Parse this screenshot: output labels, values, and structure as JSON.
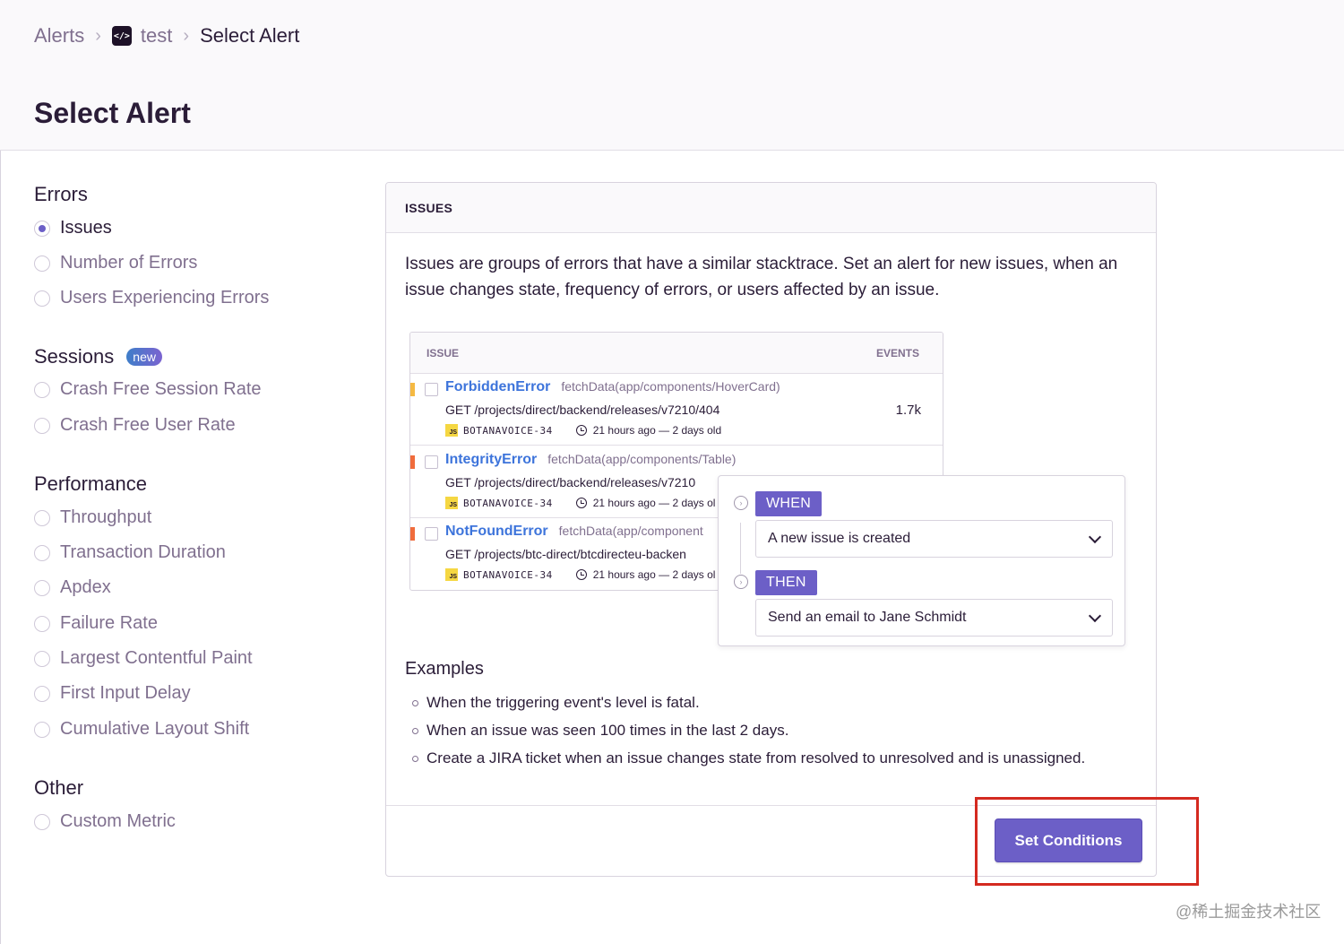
{
  "breadcrumb": {
    "alerts": "Alerts",
    "project_icon": "</>",
    "project": "test",
    "current": "Select Alert"
  },
  "page_title": "Select Alert",
  "groups": {
    "errors": {
      "title": "Errors",
      "options": [
        "Issues",
        "Number of Errors",
        "Users Experiencing Errors"
      ]
    },
    "sessions": {
      "title": "Sessions",
      "badge": "new",
      "options": [
        "Crash Free Session Rate",
        "Crash Free User Rate"
      ]
    },
    "performance": {
      "title": "Performance",
      "options": [
        "Throughput",
        "Transaction Duration",
        "Apdex",
        "Failure Rate",
        "Largest Contentful Paint",
        "First Input Delay",
        "Cumulative Layout Shift"
      ]
    },
    "other": {
      "title": "Other",
      "options": [
        "Custom Metric"
      ]
    }
  },
  "selected_option": "Issues",
  "panel": {
    "header": "ISSUES",
    "description": "Issues are groups of errors that have a similar stacktrace. Set an alert for new issues, when an issue changes state, frequency of errors, or users affected by an issue.",
    "issue_list": {
      "col_issue": "ISSUE",
      "col_events": "EVENTS",
      "rows": [
        {
          "name": "ForbiddenError",
          "culprit": "fetchData(app/components/HoverCard)",
          "path": "GET /projects/direct/backend/releases/v7210/404",
          "platform": "JS",
          "short_id": "BOTANAVOICE-34",
          "time": "21 hours ago — 2 days old",
          "events": "1.7k",
          "level_color": "#f5b942"
        },
        {
          "name": "IntegrityError",
          "culprit": "fetchData(app/components/Table)",
          "path": "GET /projects/direct/backend/releases/v7210",
          "platform": "JS",
          "short_id": "BOTANAVOICE-34",
          "time": "21 hours ago — 2 days ol",
          "events": "",
          "level_color": "#f06c3c"
        },
        {
          "name": "NotFoundError",
          "culprit": "fetchData(app/component",
          "path": "GET /projects/btc-direct/btcdirecteu-backen",
          "platform": "JS",
          "short_id": "BOTANAVOICE-34",
          "time": "21 hours ago — 2 days ol",
          "events": "",
          "level_color": "#f06c3c"
        }
      ]
    },
    "rule": {
      "when_label": "WHEN",
      "when_value": "A new issue is created",
      "then_label": "THEN",
      "then_value": "Send an email to Jane Schmidt"
    },
    "examples_title": "Examples",
    "examples": [
      "When the triggering event's level is fatal.",
      "When an issue was seen 100 times in the last 2 days.",
      "Create a JIRA ticket when an issue changes state from resolved to unresolved and is unassigned."
    ],
    "button": "Set Conditions"
  },
  "watermark": "@稀土掘金技术社区",
  "colors": {
    "accent": "#6c5fc7",
    "link": "#3d74db",
    "highlight": "#d42a20"
  }
}
